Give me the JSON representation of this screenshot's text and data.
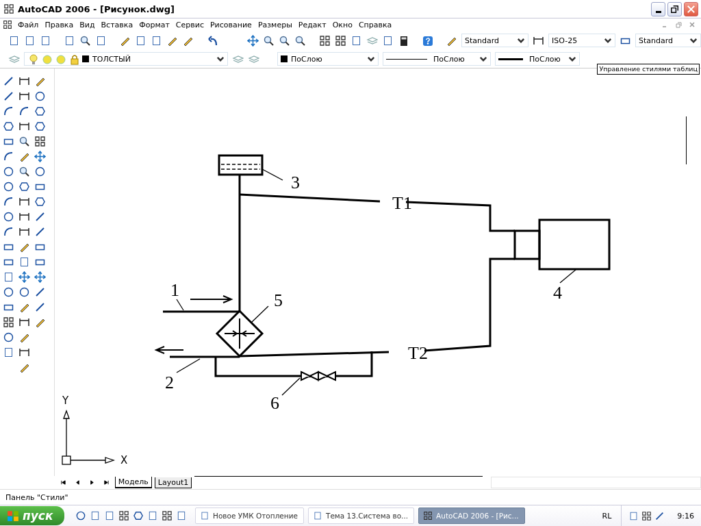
{
  "window": {
    "title": "AutoCAD 2006 - [Рисунок.dwg]"
  },
  "menu": [
    "Файл",
    "Правка",
    "Вид",
    "Вставка",
    "Формат",
    "Сервис",
    "Рисование",
    "Размеры",
    "Редакт",
    "Окно",
    "Справка"
  ],
  "styles_toolbar": {
    "text_style": "Standard",
    "dim_style": "ISO-25",
    "table_style": "Standard"
  },
  "properties_bar": {
    "layer": "ТОЛСТЫЙ",
    "color_setting": "ПоСлою",
    "linetype": "ПоСлою",
    "lineweight": "ПоСлою"
  },
  "tooltip": "Управление стилями таблиц",
  "drawing": {
    "labels": [
      "1",
      "2",
      "3",
      "4",
      "5",
      "6",
      "T1",
      "T2"
    ]
  },
  "ucs": {
    "x_label": "X",
    "y_label": "Y"
  },
  "layout_tabs": [
    {
      "label": "Модель",
      "selected": true
    },
    {
      "label": "Layout1",
      "selected": false
    }
  ],
  "command_line": "Панель \"Стили\"",
  "taskbar": {
    "start": "пуск",
    "tasks": [
      {
        "label": "Новое УМК Отопление",
        "selected": false
      },
      {
        "label": "Тема 13.Система во...",
        "selected": false
      },
      {
        "label": "AutoCAD 2006 - [Рис...",
        "selected": true
      }
    ],
    "language": "RL",
    "clock": "9:16"
  }
}
